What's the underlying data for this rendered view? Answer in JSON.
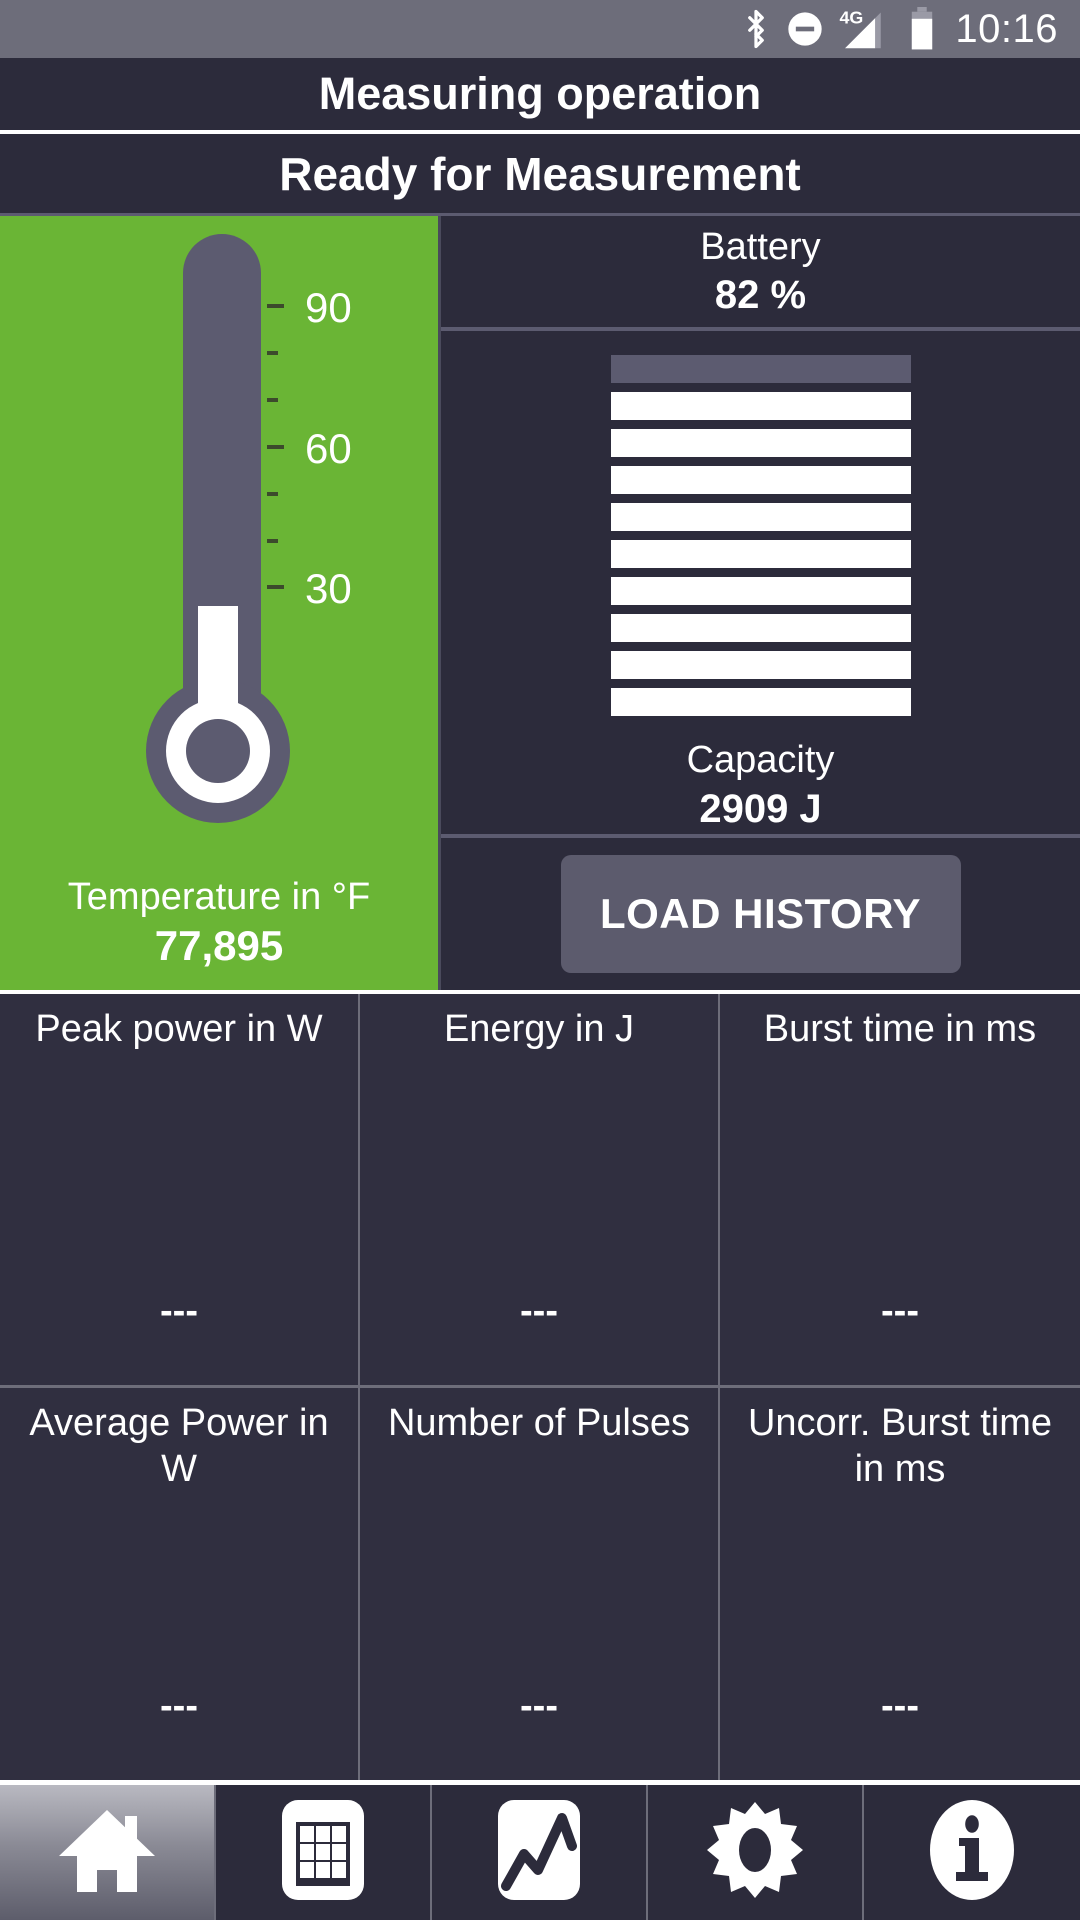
{
  "statusbar": {
    "icons": [
      "bluetooth-icon",
      "do-not-disturb-icon",
      "signal-4g-icon",
      "battery-icon"
    ],
    "signal_label": "4G",
    "time": "10:16"
  },
  "header": {
    "title": "Measuring operation",
    "status": "Ready for Measurement"
  },
  "thermometer": {
    "caption": "Temperature in °F",
    "value": "77,895",
    "scale_labels": [
      "90",
      "60",
      "30"
    ],
    "background_color": "#6ab535",
    "tube_color": "#5c5b70",
    "fill_color": "#ffffff"
  },
  "battery": {
    "label": "Battery",
    "value": "82 %"
  },
  "capacity": {
    "label": "Capacity",
    "value": "2909 J",
    "segments_total": 10,
    "segments_filled": 9
  },
  "actions": {
    "load_history": "LOAD HISTORY"
  },
  "metrics": [
    [
      {
        "label": "Peak power in W",
        "value": "---"
      },
      {
        "label": "Energy in J",
        "value": "---"
      },
      {
        "label": "Burst time in ms",
        "value": "---"
      }
    ],
    [
      {
        "label": "Average Power in W",
        "value": "---"
      },
      {
        "label": "Number of Pulses",
        "value": "---"
      },
      {
        "label": "Uncorr. Burst time in ms",
        "value": "---"
      }
    ]
  ],
  "nav": [
    {
      "name": "home-icon",
      "active": true
    },
    {
      "name": "table-icon",
      "active": false
    },
    {
      "name": "chart-icon",
      "active": false
    },
    {
      "name": "gear-icon",
      "active": false
    },
    {
      "name": "info-icon",
      "active": false
    }
  ],
  "chart_data": {
    "type": "bar",
    "title": "Temperature gauge and capacity gauge",
    "gauges": [
      {
        "name": "Thermometer",
        "unit": "°F",
        "value": 77.895,
        "display_value": "77,895",
        "axis_ticks": [
          30,
          60,
          90
        ],
        "minor_ticks_between": 2,
        "ylim": [
          10,
          110
        ],
        "label": "Temperature in °F"
      },
      {
        "name": "Capacity bar gauge",
        "unit": "J",
        "value": 2909,
        "display_value": "2909 J",
        "segments_total": 10,
        "segments_filled": 9,
        "label": "Capacity"
      },
      {
        "name": "Battery",
        "unit": "%",
        "value": 82,
        "display_value": "82 %",
        "label": "Battery"
      }
    ]
  }
}
